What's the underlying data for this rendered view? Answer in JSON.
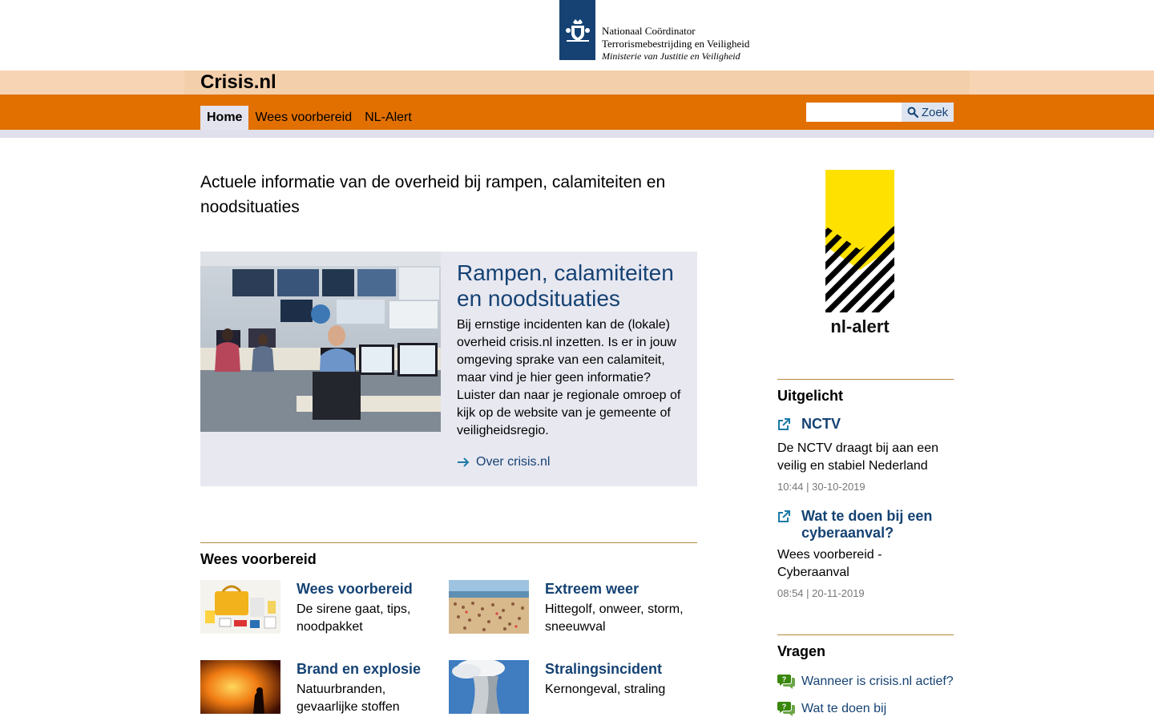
{
  "header": {
    "logo": {
      "line1": "Nationaal Coördinator",
      "line2": "Terrorismebestrijding en Veiligheid",
      "line3": "Ministerie van Justitie en Veiligheid"
    },
    "site_title": "Crisis.nl"
  },
  "nav": {
    "items": [
      {
        "label": "Home",
        "active": true
      },
      {
        "label": "Wees voorbereid",
        "active": false
      },
      {
        "label": "NL-Alert",
        "active": false
      }
    ],
    "search": {
      "placeholder": "",
      "button_label": "Zoek"
    }
  },
  "main": {
    "intro": "Actuele informatie van de overheid bij rampen, calamiteiten en noodsituaties",
    "feature": {
      "title": "Rampen, calamiteiten en noodsituaties",
      "body": "Bij ernstige incidenten kan de (lokale) overheid crisis.nl inzetten. Is er in jouw omgeving sprake van een calamiteit, maar vind je hier geen informatie? Luister dan naar je regionale omroep of kijk op de website van je gemeente of veiligheidsregio.",
      "link": "Over crisis.nl"
    },
    "prepared": {
      "title": "Wees voorbereid",
      "tiles": [
        {
          "title": "Wees voorbereid",
          "desc": "De sirene gaat, tips, noodpakket"
        },
        {
          "title": "Extreem weer",
          "desc": "Hittegolf, onweer, storm, sneeuwval"
        },
        {
          "title": "Brand en explosie",
          "desc": "Natuurbranden, gevaarlijke stoffen"
        },
        {
          "title": "Stralingsincident",
          "desc": "Kernongeval, straling"
        }
      ]
    }
  },
  "sidebar": {
    "nl_alert_logo_text": "nl-alert",
    "uitgelicht": {
      "title": "Uitgelicht",
      "items": [
        {
          "title": "NCTV",
          "desc": "De NCTV draagt bij aan een veilig en stabiel Nederland",
          "meta": "10:44 | 30-10-2019"
        },
        {
          "title": "Wat te doen bij een cyberaanval?",
          "desc": "Wees voorbereid - Cyberaanval",
          "meta": "08:54 | 20-11-2019"
        }
      ]
    },
    "vragen": {
      "title": "Vragen",
      "items": [
        "Wanneer is crisis.nl actief?",
        "Wat te doen bij"
      ]
    }
  },
  "colors": {
    "nav_orange": "#e17000",
    "title_band": "#f7d4b3",
    "link_blue": "#154273",
    "feature_bg": "#e8e8f1",
    "faq_green": "#39870c",
    "nl_alert_yellow": "#ffe100"
  },
  "icons": {
    "search": "magnifier-icon",
    "feature_link": "arrow-right-icon",
    "news": "external-link-icon",
    "faq": "question-bubble-icon"
  }
}
